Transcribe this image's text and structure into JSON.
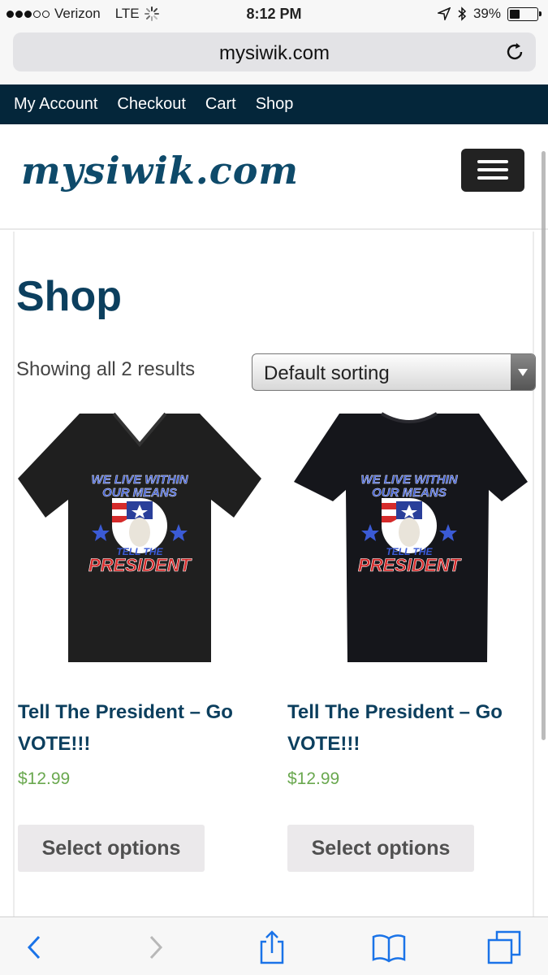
{
  "status_bar": {
    "carrier": "Verizon",
    "network": "LTE",
    "time": "8:12 PM",
    "battery": "39%",
    "battery_level": 0.39,
    "signal_bars": 3
  },
  "browser": {
    "url": "mysiwik.com"
  },
  "nav": {
    "items": [
      "My Account",
      "Checkout",
      "Cart",
      "Shop"
    ]
  },
  "header": {
    "logo": "mysiwik.com"
  },
  "shop": {
    "title": "Shop",
    "result_count": "Showing all 2 results",
    "sort_selected": "Default sorting"
  },
  "products": [
    {
      "title": "Tell The President – Go VOTE!!!",
      "price": "$12.99",
      "button": "Select options",
      "shirt_style": "v-neck",
      "shirt_color": "#1f1f1f",
      "print_lines": [
        "WE LIVE WITHIN",
        "OUR MEANS",
        "TELL THE",
        "PRESIDENT"
      ]
    },
    {
      "title": "Tell The President – Go VOTE!!!",
      "price": "$12.99",
      "button": "Select options",
      "shirt_style": "crew-neck",
      "shirt_color": "#15161b",
      "print_lines": [
        "WE LIVE WITHIN",
        "OUR MEANS",
        "TELL THE",
        "PRESIDENT"
      ]
    }
  ],
  "colors": {
    "nav_bg": "#04263a",
    "title": "#0c3f5e",
    "price": "#6aa84f",
    "button_bg": "#ebe9eb"
  }
}
